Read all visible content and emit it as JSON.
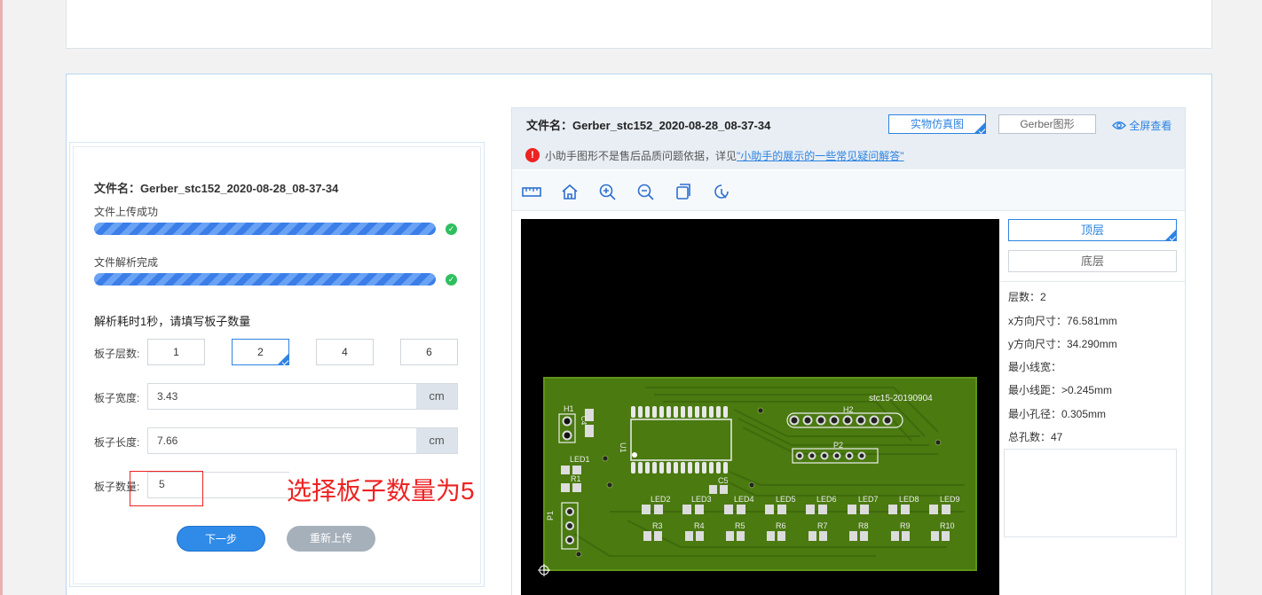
{
  "colors": {
    "accent": "#2d83e0",
    "progress": "#3b7ee8",
    "success": "#2fbf5f",
    "annotation": "#e22222",
    "pcb_green": "#4a7a10"
  },
  "left": {
    "file_name": "文件名：Gerber_stc152_2020-08-28_08-37-34",
    "upload_status": "文件上传成功",
    "parse_status": "文件解析完成",
    "check_mark": "✓",
    "progress_upload_pct": 100,
    "progress_parse_pct": 100,
    "heading": "解析耗时1秒，请填写板子数量",
    "layers_label": "板子层数:",
    "layer_options": [
      "1",
      "2",
      "4",
      "6"
    ],
    "layer_selected": "2",
    "width_label": "板子宽度:",
    "width_value": "3.43",
    "length_label": "板子长度:",
    "length_value": "7.66",
    "unit": "cm",
    "qty_label": "板子数量:",
    "qty_value": "5",
    "next_button": "下一步",
    "reupload_button": "重新上传"
  },
  "annotation": "选择板子数量为5",
  "right": {
    "file_name": "文件名：Gerber_stc152_2020-08-28_08-37-34",
    "tab_real": "实物仿真图",
    "tab_gerber": "Gerber图形",
    "fullscreen": "全屏查看",
    "warn_icon": "!",
    "warn_text": "小助手图形不是售后品质问题依据，详见",
    "warn_link": "\"小助手的展示的一些常见疑问解答\"",
    "tools": [
      "ruler-icon",
      "home-icon",
      "zoom-in-icon",
      "zoom-out-icon",
      "layers-icon",
      "rotate-icon"
    ],
    "top_layer": "顶层",
    "bottom_layer": "底层",
    "specs": {
      "layers": "层数：2",
      "x_size": "x方向尺寸：76.581mm",
      "y_size": "y方向尺寸：34.290mm",
      "min_width": "最小线宽：",
      "min_spacing": "最小线距：>0.245mm",
      "min_hole": "最小孔径：0.305mm",
      "total_holes": "总孔数：47"
    }
  },
  "pcb": {
    "silk_title": "stc15-20190904",
    "h1": "H1",
    "h2": "H2",
    "c4": "C4",
    "u1": "U1",
    "p2": "P2",
    "p1": "P1",
    "led1": "LED1",
    "r1": "R1",
    "c5": "C5",
    "leds": [
      "LED2",
      "LED3",
      "LED4",
      "LED5",
      "LED6",
      "LED7",
      "LED8",
      "LED9"
    ],
    "resistors": [
      "R3",
      "R4",
      "R5",
      "R6",
      "R7",
      "R8",
      "R9",
      "R10"
    ]
  }
}
